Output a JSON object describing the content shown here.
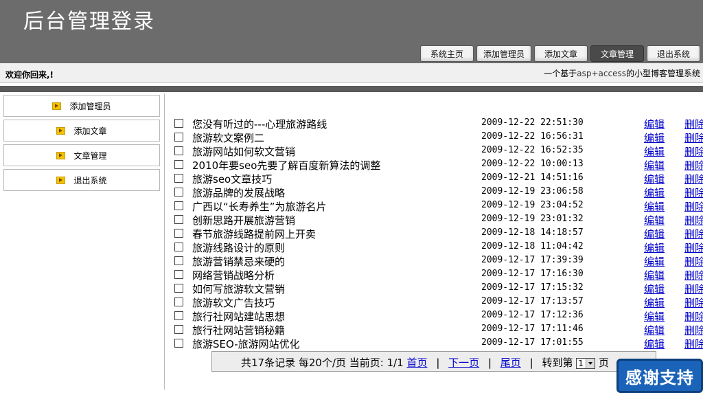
{
  "header": {
    "title": "后台管理登录"
  },
  "nav": [
    {
      "label": "系统主页"
    },
    {
      "label": "添加管理员"
    },
    {
      "label": "添加文章"
    },
    {
      "label": "文章管理"
    },
    {
      "label": "退出系统"
    }
  ],
  "welcome": "欢迎你回来,!",
  "slogan": {
    "prefix": "一个基于",
    "highlight": "asp+access",
    "suffix": "的小型博客管理系统"
  },
  "sidebar": [
    {
      "label": "添加管理员"
    },
    {
      "label": "添加文章"
    },
    {
      "label": "文章管理"
    },
    {
      "label": "退出系统"
    }
  ],
  "articles": [
    {
      "title": "您没有听过的---心理旅游路线",
      "date": "2009-12-22 22:51:30"
    },
    {
      "title": "旅游软文案例二",
      "date": "2009-12-22 16:56:31"
    },
    {
      "title": "旅游网站如何软文营销",
      "date": "2009-12-22 16:52:35"
    },
    {
      "title": "2010年要seo先要了解百度新算法的调整",
      "date": "2009-12-22 10:00:13"
    },
    {
      "title": "旅游seo文章技巧",
      "date": "2009-12-21 14:51:16"
    },
    {
      "title": "旅游品牌的发展战略",
      "date": "2009-12-19 23:06:58"
    },
    {
      "title": "广西以“长寿养生”为旅游名片",
      "date": "2009-12-19 23:04:52"
    },
    {
      "title": "创新思路开展旅游营销",
      "date": "2009-12-19 23:01:32"
    },
    {
      "title": "春节旅游线路提前网上开卖",
      "date": "2009-12-18 14:18:57"
    },
    {
      "title": "旅游线路设计的原则",
      "date": "2009-12-18 11:04:42"
    },
    {
      "title": "旅游营销禁忌来硬的",
      "date": "2009-12-17 17:39:39"
    },
    {
      "title": "网络营销战略分析",
      "date": "2009-12-17 17:16:30"
    },
    {
      "title": "如何写旅游软文营销",
      "date": "2009-12-17 17:15:32"
    },
    {
      "title": "旅游软文广告技巧",
      "date": "2009-12-17 17:13:57"
    },
    {
      "title": "旅行社网站建站思想",
      "date": "2009-12-17 17:12:36"
    },
    {
      "title": "旅行社网站营销秘籍",
      "date": "2009-12-17 17:11:46"
    },
    {
      "title": "旅游SEO-旅游网站优化",
      "date": "2009-12-17 17:01:55"
    }
  ],
  "row_actions": {
    "edit": "编辑",
    "delete": "删除"
  },
  "pager": {
    "summary": "共17条记录 每20个/页 当前页: 1/1",
    "first": "首页",
    "next": "下一页",
    "last": "尾页",
    "sep": "|",
    "goto": "转到第",
    "page_value": "1",
    "page_unit": "页"
  },
  "support_button": "感谢支持"
}
